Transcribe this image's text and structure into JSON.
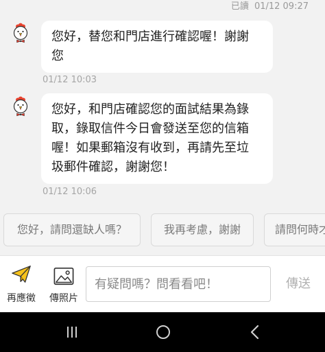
{
  "read_receipt": {
    "label": "已讀",
    "time": "01/12 09:27"
  },
  "messages": [
    {
      "lines": [
        "您好，替您和門店進行確認喔！謝謝",
        "您"
      ],
      "time": "01/12 10:03"
    },
    {
      "lines": [
        "您好，和門店確認您的面試結果為錄",
        "取，錄取信件今日會發送至您的信箱",
        "喔！如果郵箱沒有收到，再請先至垃",
        "圾郵件確認，謝謝您！"
      ],
      "time": "01/12 10:06"
    }
  ],
  "quick_replies": [
    "您好，請問還缺人嗎？",
    "我再考慮，謝謝",
    "請問何時才"
  ],
  "actions": {
    "apply_label": "再應徵",
    "photo_label": "傳照片"
  },
  "composer": {
    "placeholder": "有疑問嗎？問看看吧！",
    "send_label": "傳送"
  },
  "icons": {
    "avatar": "chicken-avatar",
    "apply": "paper-plane-icon",
    "photo": "image-icon",
    "nav_recents": "recents-icon",
    "nav_home": "home-icon",
    "nav_back": "back-icon"
  },
  "colors": {
    "background": "#f2f2f2",
    "bubble": "#ffffff",
    "accent_yellow": "#f7c21a",
    "avatar_comb": "#e8432f",
    "nav_bar": "#000000"
  }
}
